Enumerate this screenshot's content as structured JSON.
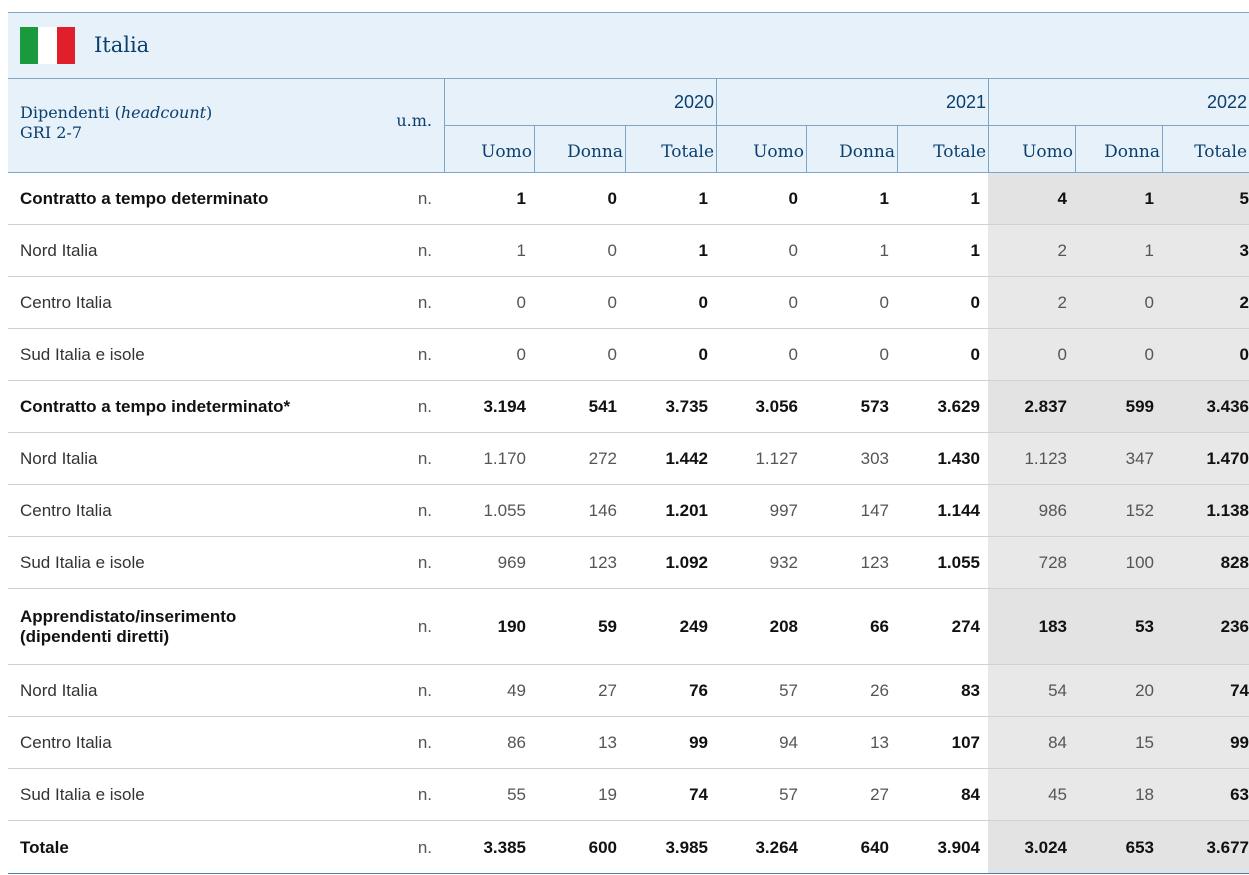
{
  "title": "Italia",
  "header": {
    "label_main": "Dipendenti (",
    "label_italic": "headcount",
    "label_close": ")",
    "label_gri": "GRI 2-7",
    "um": "u.m.",
    "years": [
      "2020",
      "2021",
      "2022"
    ],
    "sub": [
      "Uomo",
      "Donna",
      "Totale"
    ]
  },
  "rows": [
    {
      "label": "Contratto a tempo determinato",
      "um": "n.",
      "bold": true,
      "values": [
        "1",
        "0",
        "1",
        "0",
        "1",
        "1",
        "4",
        "1",
        "5"
      ]
    },
    {
      "label": "Nord Italia",
      "um": "n.",
      "bold": false,
      "values": [
        "1",
        "0",
        "1",
        "0",
        "1",
        "1",
        "2",
        "1",
        "3"
      ]
    },
    {
      "label": "Centro Italia",
      "um": "n.",
      "bold": false,
      "values": [
        "0",
        "0",
        "0",
        "0",
        "0",
        "0",
        "2",
        "0",
        "2"
      ]
    },
    {
      "label": "Sud Italia e isole",
      "um": "n.",
      "bold": false,
      "values": [
        "0",
        "0",
        "0",
        "0",
        "0",
        "0",
        "0",
        "0",
        "0"
      ]
    },
    {
      "label": "Contratto a tempo indeterminato*",
      "um": "n.",
      "bold": true,
      "values": [
        "3.194",
        "541",
        "3.735",
        "3.056",
        "573",
        "3.629",
        "2.837",
        "599",
        "3.436"
      ]
    },
    {
      "label": "Nord Italia",
      "um": "n.",
      "bold": false,
      "values": [
        "1.170",
        "272",
        "1.442",
        "1.127",
        "303",
        "1.430",
        "1.123",
        "347",
        "1.470"
      ]
    },
    {
      "label": "Centro Italia",
      "um": "n.",
      "bold": false,
      "values": [
        "1.055",
        "146",
        "1.201",
        "997",
        "147",
        "1.144",
        "986",
        "152",
        "1.138"
      ]
    },
    {
      "label": "Sud Italia e isole",
      "um": "n.",
      "bold": false,
      "values": [
        "969",
        "123",
        "1.092",
        "932",
        "123",
        "1.055",
        "728",
        "100",
        "828"
      ]
    },
    {
      "label": "Apprendistato/inserimento",
      "label2": "(dipendenti diretti)",
      "um": "n.",
      "bold": true,
      "values": [
        "190",
        "59",
        "249",
        "208",
        "66",
        "274",
        "183",
        "53",
        "236"
      ]
    },
    {
      "label": "Nord Italia",
      "um": "n.",
      "bold": false,
      "values": [
        "49",
        "27",
        "76",
        "57",
        "26",
        "83",
        "54",
        "20",
        "74"
      ]
    },
    {
      "label": "Centro Italia",
      "um": "n.",
      "bold": false,
      "values": [
        "86",
        "13",
        "99",
        "94",
        "13",
        "107",
        "84",
        "15",
        "99"
      ]
    },
    {
      "label": "Sud Italia e isole",
      "um": "n.",
      "bold": false,
      "values": [
        "55",
        "19",
        "74",
        "57",
        "27",
        "84",
        "45",
        "18",
        "63"
      ]
    },
    {
      "label": "Totale",
      "um": "n.",
      "bold": true,
      "values": [
        "3.385",
        "600",
        "3.985",
        "3.264",
        "640",
        "3.904",
        "3.024",
        "653",
        "3.677"
      ]
    }
  ]
}
